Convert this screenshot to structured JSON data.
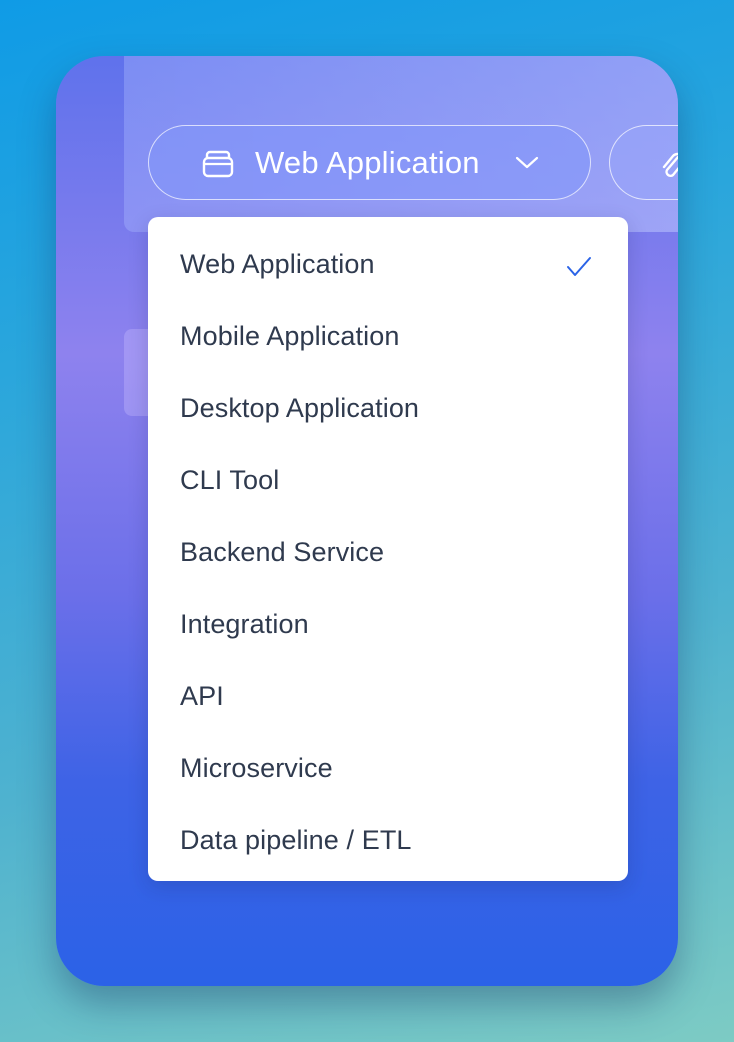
{
  "type_selector": {
    "selected_label": "Web Application",
    "icon": "stack-box-icon",
    "chevron": "chevron-down-icon"
  },
  "attachment_button": {
    "icon": "paperclip-icon"
  },
  "colors": {
    "check": "#2a63e7",
    "menu_text": "#2f3a4e"
  },
  "menu": {
    "items": [
      {
        "label": "Web Application",
        "selected": true
      },
      {
        "label": "Mobile Application",
        "selected": false
      },
      {
        "label": "Desktop Application",
        "selected": false
      },
      {
        "label": "CLI Tool",
        "selected": false
      },
      {
        "label": "Backend Service",
        "selected": false
      },
      {
        "label": "Integration",
        "selected": false
      },
      {
        "label": "API",
        "selected": false
      },
      {
        "label": "Microservice",
        "selected": false
      },
      {
        "label": "Data pipeline / ETL",
        "selected": false
      }
    ]
  }
}
